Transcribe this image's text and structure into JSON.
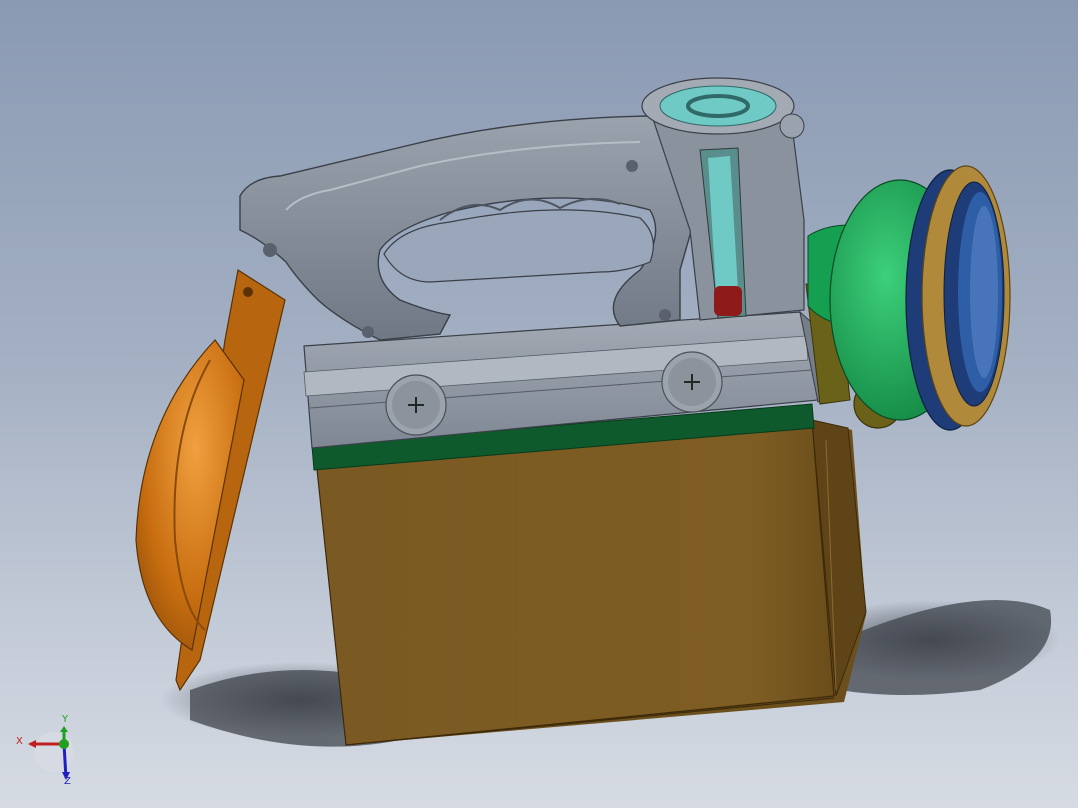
{
  "viewport": {
    "background_top": "#8a9ab3",
    "background_bottom": "#d6dbe3"
  },
  "model": {
    "parts": [
      {
        "name": "battery-body",
        "color": "#7a5a22"
      },
      {
        "name": "green-band",
        "color": "#0f5a2c"
      },
      {
        "name": "gray-cap",
        "color": "#8e96a2"
      },
      {
        "name": "handle",
        "color": "#7c8592"
      },
      {
        "name": "side-lamp-reflector",
        "color": "#c86e10"
      },
      {
        "name": "headlamp-green-housing",
        "color": "#14a050"
      },
      {
        "name": "headlamp-bezel-blue",
        "color": "#1d3c78"
      },
      {
        "name": "headlamp-bezel-gold",
        "color": "#b08a3a"
      },
      {
        "name": "indicator-cap",
        "color": "#6fc9c4"
      },
      {
        "name": "level-window",
        "color": "#5a8e8c"
      },
      {
        "name": "level-indicator-red",
        "color": "#8e1a1a"
      }
    ]
  },
  "triad": {
    "x_label": "X",
    "y_label": "Y",
    "z_label": "Z",
    "x_color": "#c02020",
    "y_color": "#20a020",
    "z_color": "#2020c0"
  }
}
